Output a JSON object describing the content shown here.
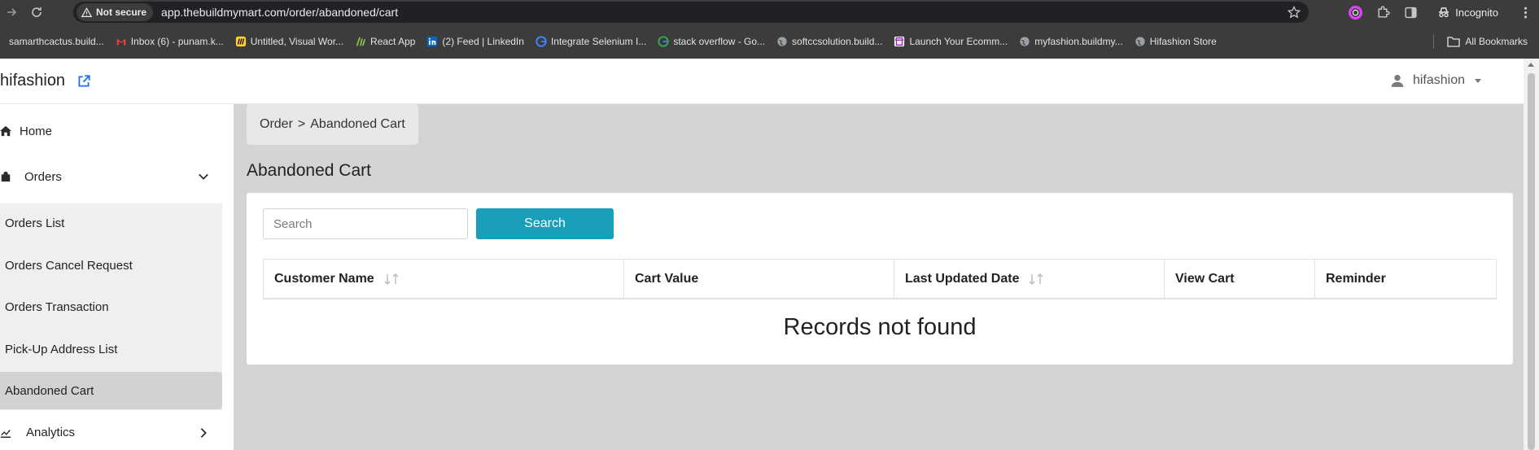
{
  "browser": {
    "not_secure_label": "Not secure",
    "url": "app.thebuildmymart.com/order/abandoned/cart",
    "incognito_label": "Incognito",
    "all_bookmarks_label": "All Bookmarks",
    "bookmarks": [
      {
        "label": "samarthcactus.build...",
        "icon": "globe-icon"
      },
      {
        "label": "Inbox (6) - punam.k...",
        "icon": "gmail-icon"
      },
      {
        "label": "Untitled, Visual Wor...",
        "icon": "miro-icon"
      },
      {
        "label": "React App",
        "icon": "react-app-icon"
      },
      {
        "label": "(2) Feed | LinkedIn",
        "icon": "linkedin-icon"
      },
      {
        "label": "Integrate Selenium I...",
        "icon": "google-icon"
      },
      {
        "label": "stack overflow - Go...",
        "icon": "google-icon"
      },
      {
        "label": "softccsolution.build...",
        "icon": "globe-icon"
      },
      {
        "label": "Launch Your Ecomm...",
        "icon": "store-icon"
      },
      {
        "label": "myfashion.buildmy...",
        "icon": "globe-icon"
      },
      {
        "label": "Hifashion Store",
        "icon": "globe-icon"
      }
    ]
  },
  "header": {
    "brand": "hifashion",
    "user": "hifashion"
  },
  "sidebar": {
    "home": "Home",
    "orders": "Orders",
    "orders_sub": [
      "Orders List",
      "Orders Cancel Request",
      "Orders Transaction",
      "Pick-Up Address List",
      "Abandoned Cart"
    ],
    "active_sub": "Abandoned Cart",
    "analytics": "Analytics"
  },
  "breadcrumb": {
    "parent": "Order",
    "separator": ">",
    "current": "Abandoned Cart"
  },
  "page": {
    "title": "Abandoned Cart",
    "search_placeholder": "Search",
    "search_button": "Search",
    "columns": [
      {
        "label": "Customer Name",
        "sortable": true
      },
      {
        "label": "Cart Value",
        "sortable": false
      },
      {
        "label": "Last Updated Date",
        "sortable": true
      },
      {
        "label": "View Cart",
        "sortable": false
      },
      {
        "label": "Reminder",
        "sortable": false
      }
    ],
    "empty_message": "Records not found"
  },
  "colors": {
    "accent": "#1a9fba",
    "content_bg": "#d4d4d4",
    "active_item": "#d3d1d3"
  }
}
